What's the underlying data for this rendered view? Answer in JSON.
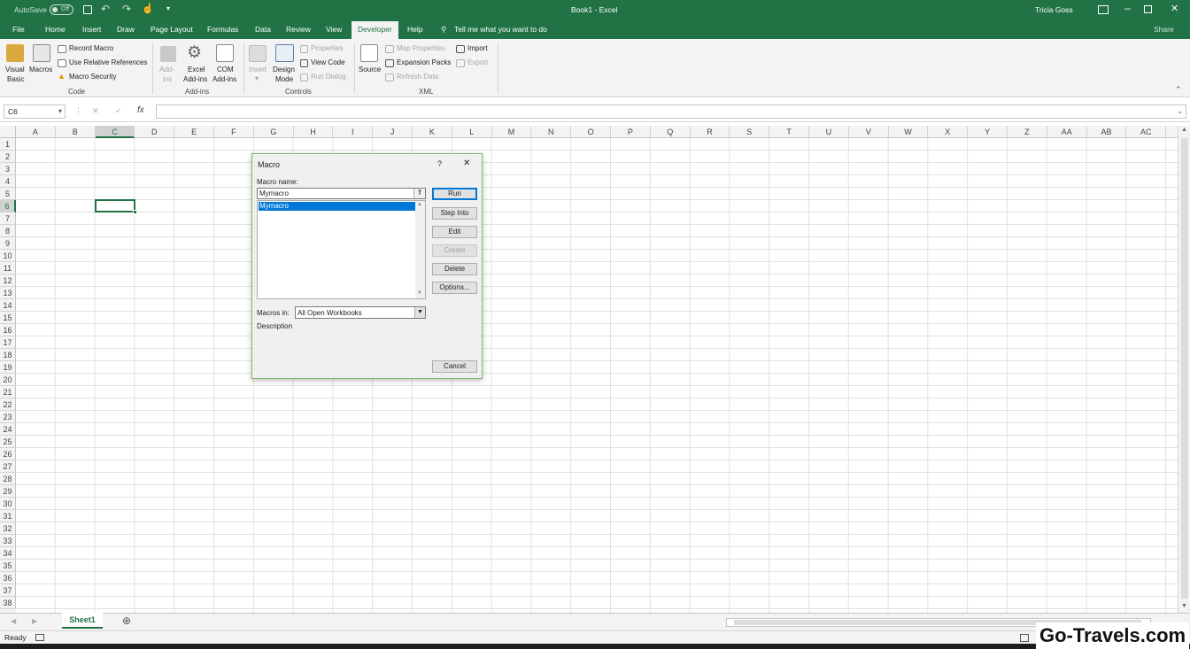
{
  "title": {
    "autosave_label": "AutoSave",
    "autosave_state": "Off",
    "window_title": "Book1 - Excel",
    "user": "Tricia Goss",
    "share": "Share"
  },
  "tabs": [
    "File",
    "Home",
    "Insert",
    "Draw",
    "Page Layout",
    "Formulas",
    "Data",
    "Review",
    "View",
    "Developer",
    "Help"
  ],
  "tell_me": "Tell me what you want to do",
  "ribbon": {
    "code": {
      "visual_basic_1": "Visual",
      "visual_basic_2": "Basic",
      "macros": "Macros",
      "record_macro": "Record Macro",
      "use_relative": "Use Relative References",
      "macro_security": "Macro Security",
      "group": "Code"
    },
    "addins": {
      "addins_1": "Add-",
      "addins_2": "ins",
      "excel_addins_1": "Excel",
      "excel_addins_2": "Add-ins",
      "com_addins_1": "COM",
      "com_addins_2": "Add-ins",
      "group": "Add-ins"
    },
    "controls": {
      "insert": "Insert",
      "design_mode_1": "Design",
      "design_mode_2": "Mode",
      "properties": "Properties",
      "view_code": "View Code",
      "run_dialog": "Run Dialog",
      "group": "Controls"
    },
    "xml": {
      "source": "Source",
      "map_properties": "Map Properties",
      "expansion_packs": "Expansion Packs",
      "refresh_data": "Refresh Data",
      "import": "Import",
      "export": "Export",
      "group": "XML"
    }
  },
  "formula_bar": {
    "name_box": "C6",
    "cancel_glyph": "✕",
    "enter_glyph": "✓",
    "fx": "fx"
  },
  "columns": [
    "A",
    "B",
    "C",
    "D",
    "E",
    "F",
    "G",
    "H",
    "I",
    "J",
    "K",
    "L",
    "M",
    "N",
    "O",
    "P",
    "Q",
    "R",
    "S",
    "T",
    "U",
    "V",
    "W",
    "X",
    "Y",
    "Z",
    "AA",
    "AB",
    "AC"
  ],
  "rows": [
    "1",
    "2",
    "3",
    "4",
    "5",
    "6",
    "7",
    "8",
    "9",
    "10",
    "11",
    "12",
    "13",
    "14",
    "15",
    "16",
    "17",
    "18",
    "19",
    "20",
    "21",
    "22",
    "23",
    "24",
    "25",
    "26",
    "27",
    "28",
    "29",
    "30",
    "31",
    "32",
    "33",
    "34",
    "35",
    "36",
    "37",
    "38"
  ],
  "selected_cell": "C6",
  "sheet_tab": "Sheet1",
  "status": "Ready",
  "dialog": {
    "title": "Macro",
    "help": "?",
    "close": "✕",
    "macro_name_label": "Macro name:",
    "macro_name_value": "Mymacro",
    "list_items": [
      "Mymacro"
    ],
    "buttons": {
      "run": "Run",
      "step_into": "Step Into",
      "edit": "Edit",
      "create": "Create",
      "delete": "Delete",
      "options": "Options..."
    },
    "macros_in_label": "Macros in:",
    "macros_in_value": "All Open Workbooks",
    "description_label": "Description",
    "cancel": "Cancel"
  },
  "watermark": "Go-Travels.com",
  "colors": {
    "excel_green": "#217346",
    "selection_blue": "#0078d7"
  }
}
